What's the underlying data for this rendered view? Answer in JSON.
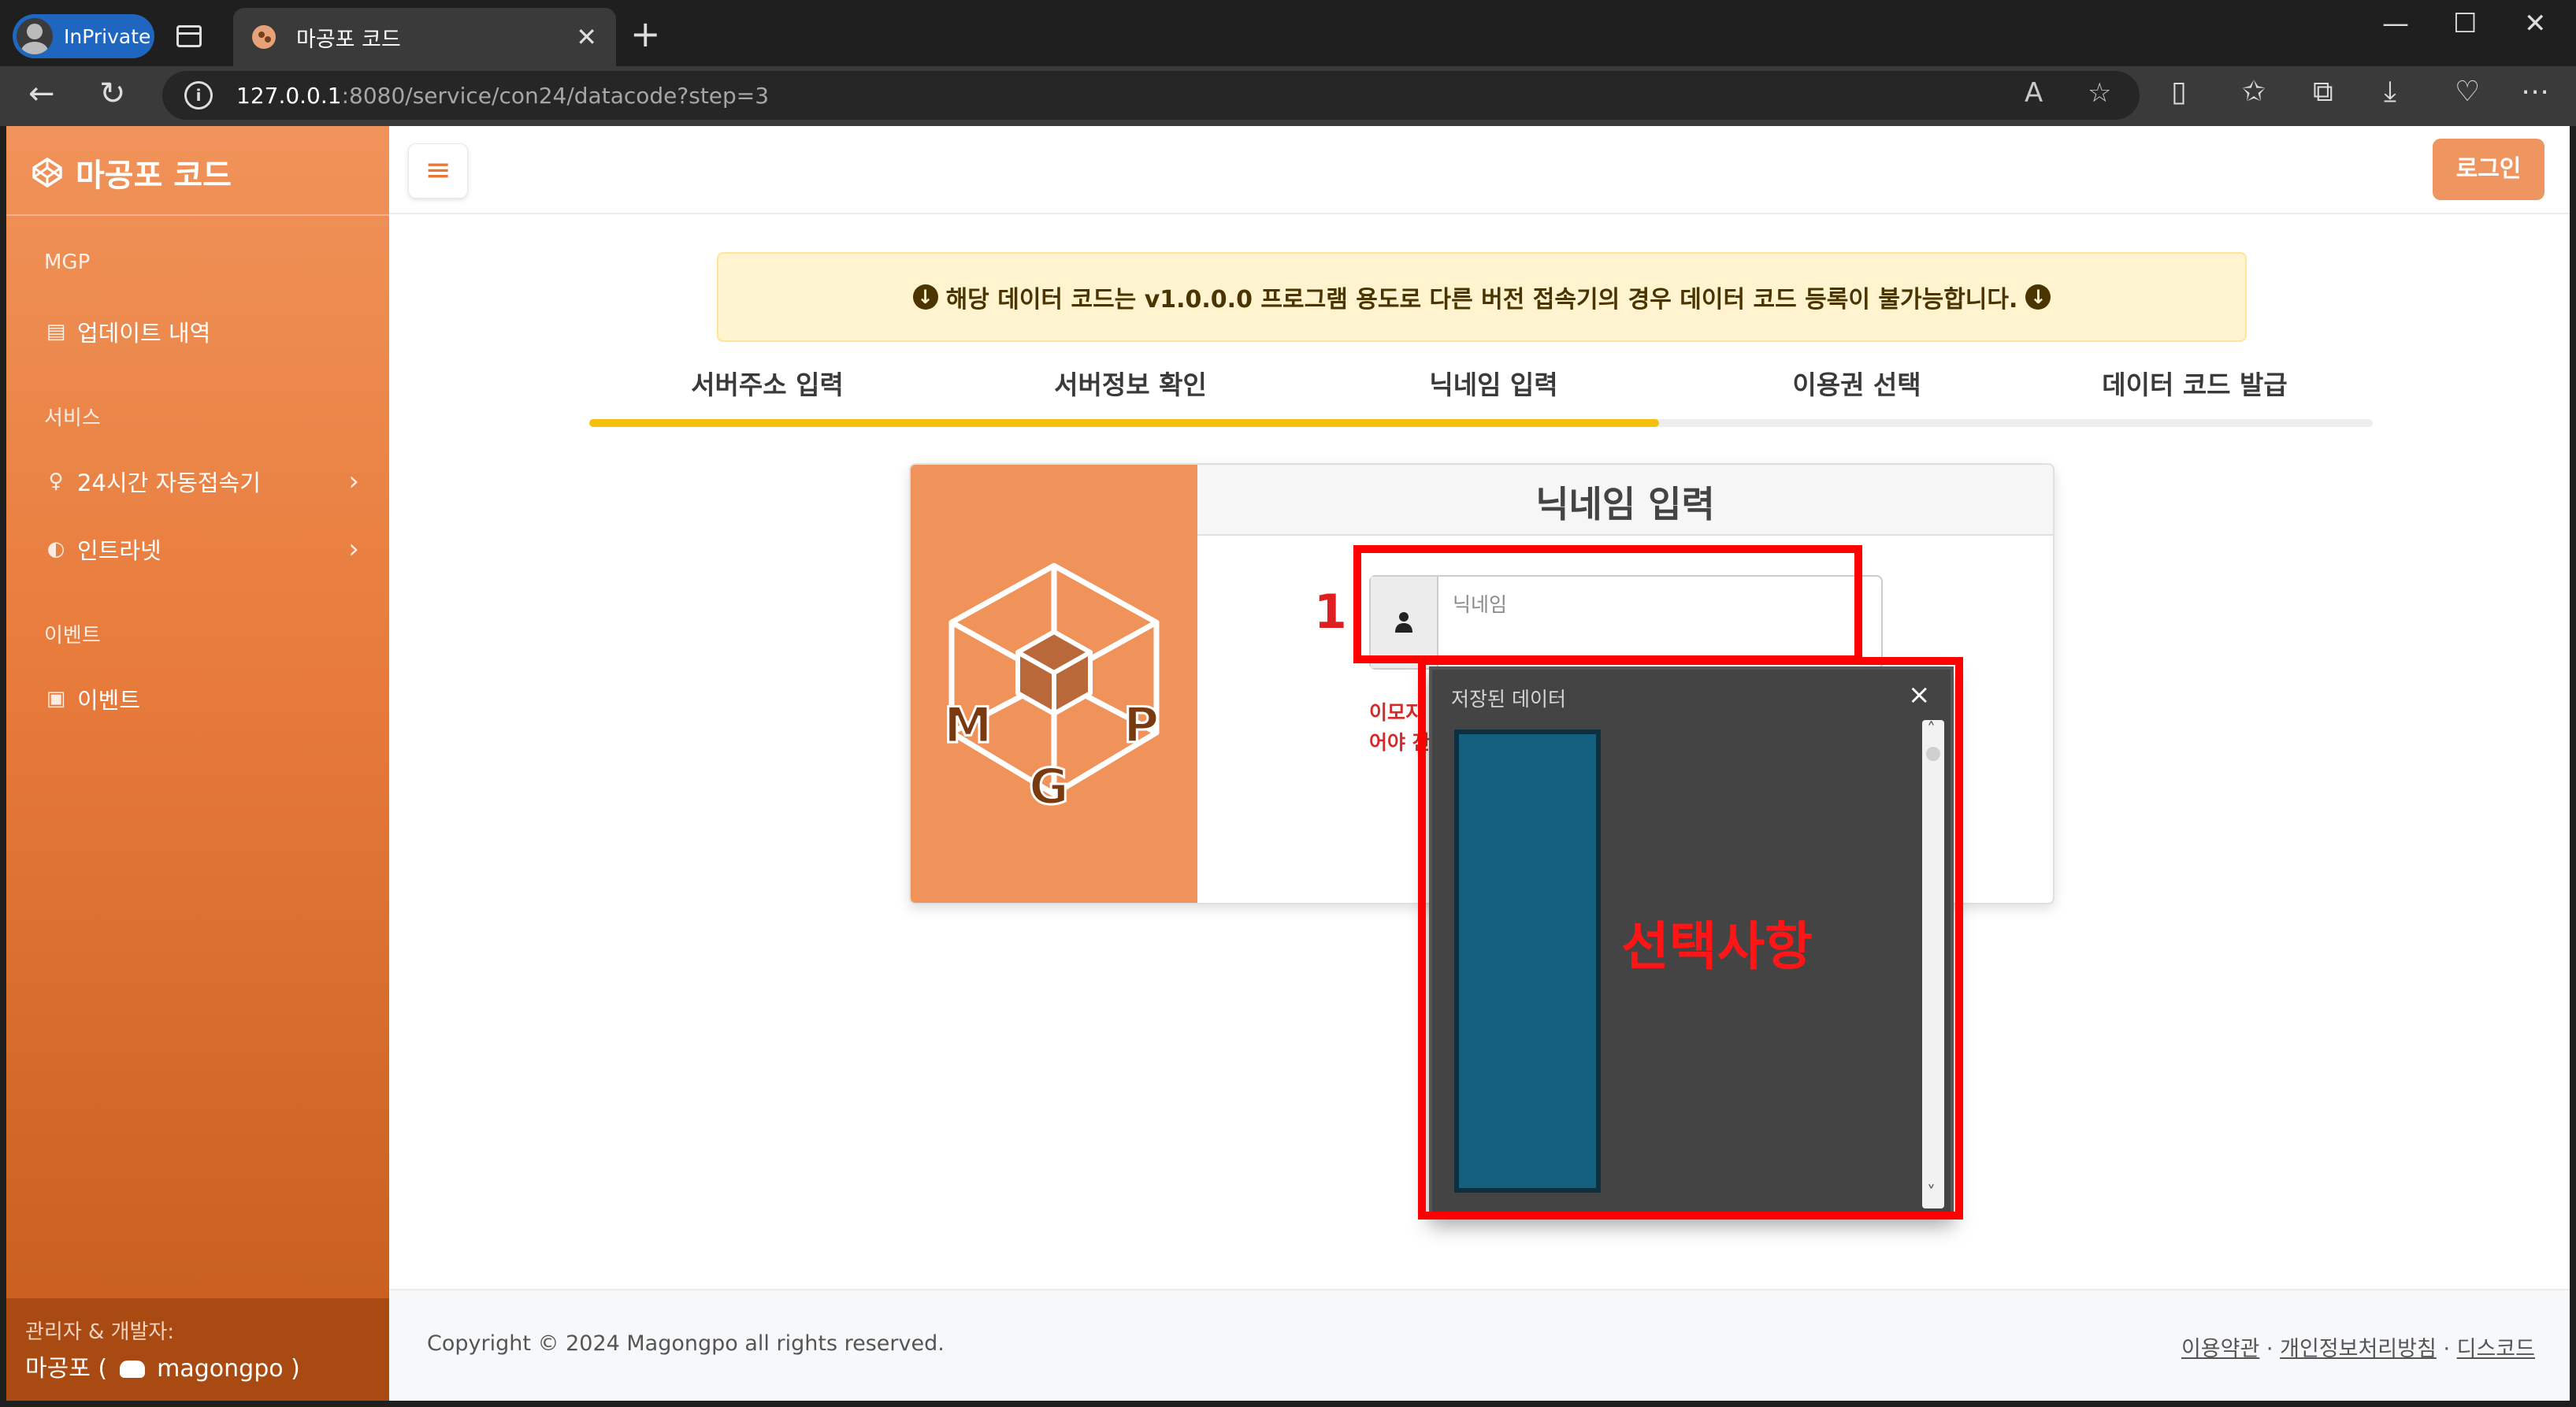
{
  "browser": {
    "inprivate_label": "InPrivate",
    "tab_title": "마공포 코드",
    "url_host": "127.0.0.1",
    "url_path": ":8080/service/con24/datacode?step=3"
  },
  "sidebar": {
    "brand": "마공포 코드",
    "sections": [
      {
        "heading": "MGP",
        "items": [
          {
            "label": "업데이트 내역",
            "icon": "clipboard-icon"
          }
        ]
      },
      {
        "heading": "서비스",
        "items": [
          {
            "label": "24시간 자동접속기",
            "icon": "lightbulb-icon"
          },
          {
            "label": "인트라넷",
            "icon": "half-circle-icon"
          }
        ]
      },
      {
        "heading": "이벤트",
        "items": [
          {
            "label": "이벤트",
            "icon": "calendar-check-icon"
          }
        ]
      }
    ],
    "footer_line1": "관리자 & 개발자:",
    "footer_name": "마공포 (",
    "footer_handle": "magongpo )"
  },
  "topnav": {
    "login_label": "로그인"
  },
  "notice": {
    "text": "해당 데이터 코드는 v1.0.0.0 프로그램 용도로 다른 버전 접속기의 경우 데이터 코드 등록이 불가능합니다."
  },
  "steps": {
    "labels": [
      "서버주소 입력",
      "서버정보 확인",
      "닉네임 입력",
      "이용권 선택",
      "데이터 코드 발급"
    ],
    "progress": 0.6,
    "accent": "#f6c00e"
  },
  "card": {
    "title": "닉네임 입력",
    "logo_letters": [
      "M",
      "G",
      "P"
    ],
    "nickname_placeholder": "닉네임",
    "warning_line1": "이모지",
    "warning_line2": "어야 잔"
  },
  "dropdown": {
    "title": "저장된 데이터"
  },
  "annotations": {
    "number": "1",
    "label": "선택사항",
    "color": "#ff0000"
  },
  "footer": {
    "copyright": "Copyright © 2024 Magongpo all rights reserved.",
    "links": [
      "이용약관",
      "개인정보처리방침",
      "디스코드"
    ],
    "separator": "·"
  }
}
